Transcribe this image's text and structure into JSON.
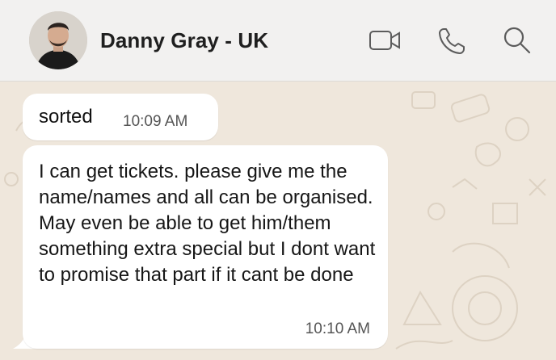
{
  "contact": {
    "name": "Danny Gray - UK"
  },
  "icons": {
    "video": "video-camera-icon",
    "call": "phone-icon",
    "search": "search-icon"
  },
  "messages": [
    {
      "text": "sorted",
      "time": "10:09 AM"
    },
    {
      "text": "I can get tickets. please give me the name/names and all can be organised. May even be able to get him/them something extra special but I dont want to promise that part if it cant be done",
      "time": "10:10 AM"
    }
  ],
  "colors": {
    "header_bg": "#f2f1f0",
    "chat_bg": "#efe7dc",
    "bubble_bg": "#ffffff"
  }
}
